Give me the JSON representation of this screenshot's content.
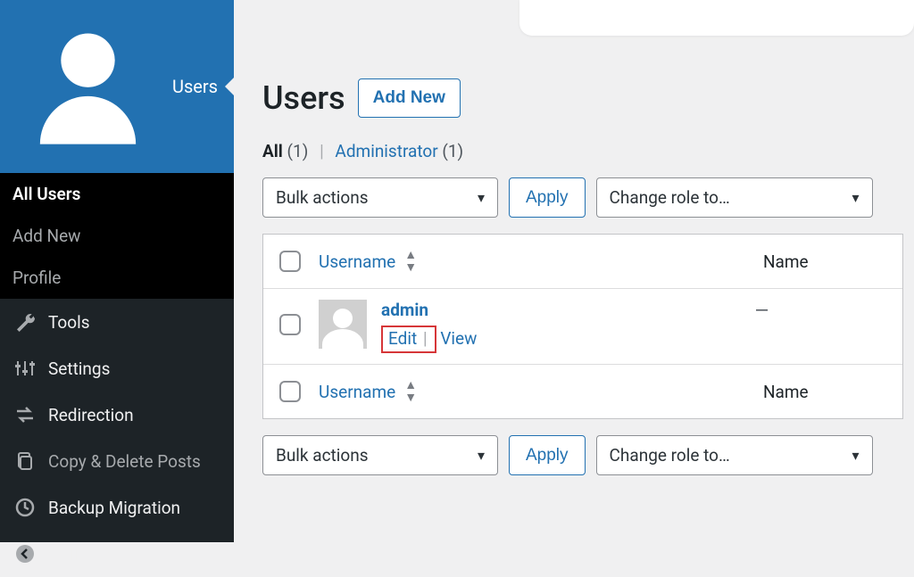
{
  "sidebar": {
    "current": {
      "label": "Users"
    },
    "submenu": [
      {
        "label": "All Users"
      },
      {
        "label": "Add New"
      },
      {
        "label": "Profile"
      }
    ],
    "items": [
      {
        "label": "Tools"
      },
      {
        "label": "Settings"
      },
      {
        "label": "Redirection"
      },
      {
        "label": "Copy & Delete Posts"
      },
      {
        "label": "Backup Migration"
      },
      {
        "label": "Collapse menu"
      }
    ]
  },
  "page": {
    "title": "Users",
    "add_new": "Add New"
  },
  "filters": {
    "all_label": "All",
    "all_count": "(1)",
    "admin_label": "Administrator",
    "admin_count": "(1)"
  },
  "toolbar": {
    "bulk_label": "Bulk actions",
    "apply_label": "Apply",
    "role_label": "Change role to…"
  },
  "table": {
    "col_username": "Username",
    "col_name": "Name",
    "row": {
      "username": "admin",
      "name": "—",
      "edit": "Edit",
      "view": "View"
    }
  }
}
